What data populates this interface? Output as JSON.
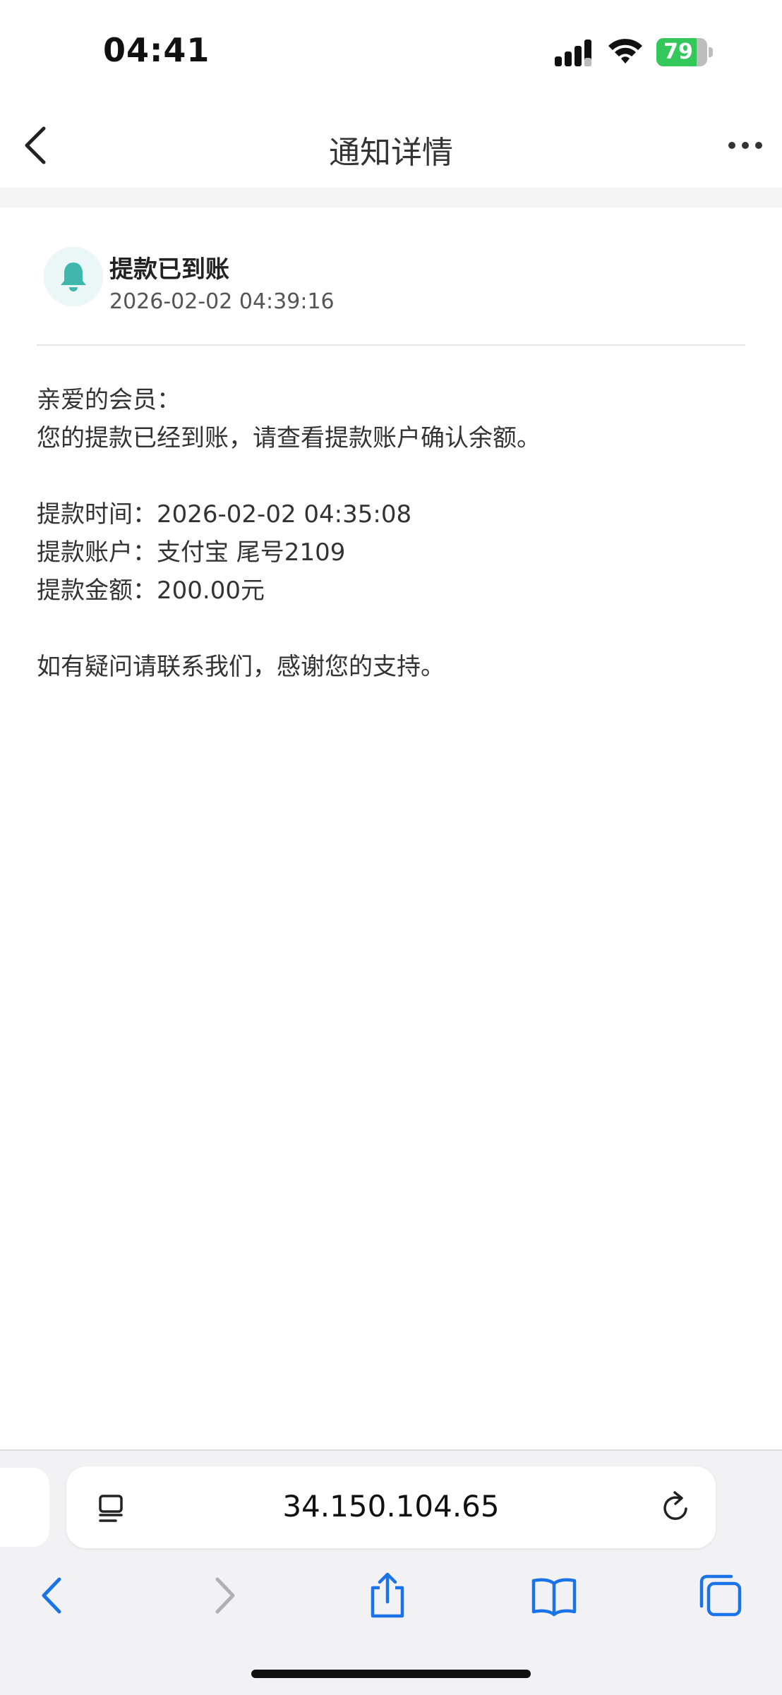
{
  "status_bar": {
    "time": "04:41",
    "battery_percent": "79",
    "battery_level": 0.79,
    "battery_color": "#34c759"
  },
  "nav": {
    "title": "通知详情",
    "back_icon": "chevron-left-icon",
    "more_icon": "ellipsis-icon"
  },
  "notice": {
    "icon": "bell-icon",
    "icon_color": "#3fb7ad",
    "title": "提款已到账",
    "timestamp": "2026-02-02 04:39:16",
    "greeting": "亲爱的会员：",
    "message": "您的提款已经到账，请查看提款账户确认余额。",
    "details": [
      "提款时间：2026-02-02 04:35:08",
      "提款账户：支付宝 尾号2109",
      "提款金额：200.00元"
    ],
    "closing": "如有疑问请联系我们，感谢您的支持。"
  },
  "browser": {
    "url": "34.150.104.65",
    "accent_color": "#1a73e8",
    "toolbar": [
      "back-icon",
      "forward-icon",
      "share-icon",
      "bookmarks-icon",
      "tabs-icon"
    ]
  }
}
